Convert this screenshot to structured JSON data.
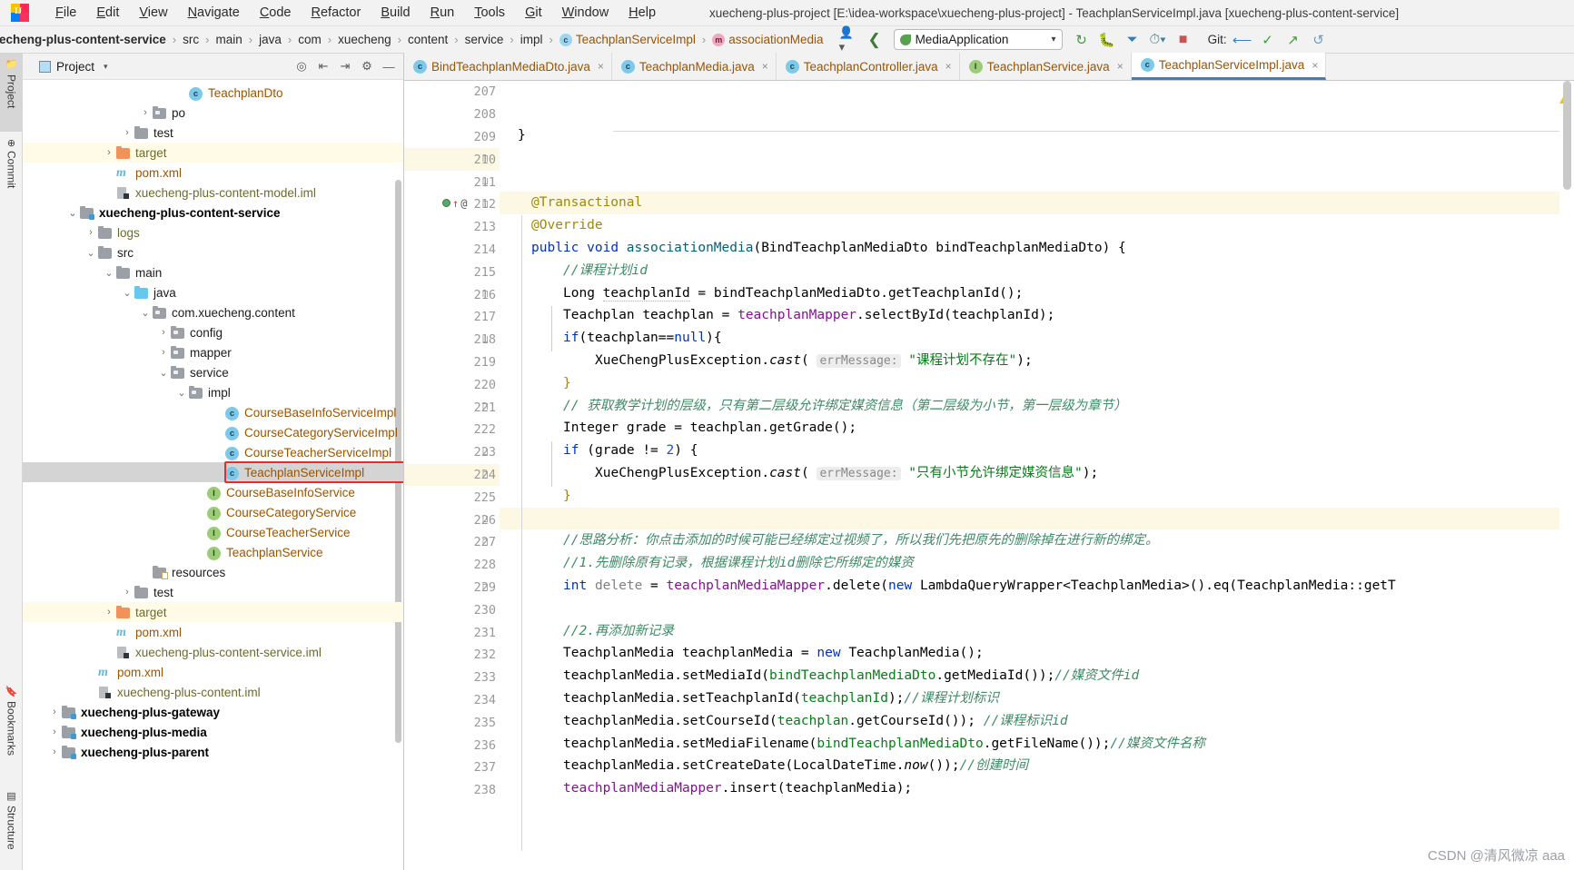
{
  "window": {
    "title": "xuecheng-plus-project [E:\\idea-workspace\\xuecheng-plus-project] - TeachplanServiceImpl.java [xuecheng-plus-content-service]",
    "logo_text": "IJ"
  },
  "menu": {
    "items": [
      {
        "label": "File",
        "mnemonic": "F"
      },
      {
        "label": "Edit",
        "mnemonic": "E"
      },
      {
        "label": "View",
        "mnemonic": "V"
      },
      {
        "label": "Navigate",
        "mnemonic": "N"
      },
      {
        "label": "Code",
        "mnemonic": "C"
      },
      {
        "label": "Refactor",
        "mnemonic": "R"
      },
      {
        "label": "Build",
        "mnemonic": "B"
      },
      {
        "label": "Run",
        "mnemonic": "R"
      },
      {
        "label": "Tools",
        "mnemonic": "T"
      },
      {
        "label": "Git",
        "mnemonic": "G"
      },
      {
        "label": "Window",
        "mnemonic": "W"
      },
      {
        "label": "Help",
        "mnemonic": "H"
      }
    ]
  },
  "breadcrumb": {
    "items": [
      {
        "label": "echeng-plus-content-service",
        "style": "bold",
        "icon": ""
      },
      {
        "label": "src",
        "style": "plain",
        "icon": ""
      },
      {
        "label": "main",
        "style": "plain",
        "icon": ""
      },
      {
        "label": "java",
        "style": "plain",
        "icon": ""
      },
      {
        "label": "com",
        "style": "plain",
        "icon": ""
      },
      {
        "label": "xuecheng",
        "style": "plain",
        "icon": ""
      },
      {
        "label": "content",
        "style": "plain",
        "icon": ""
      },
      {
        "label": "service",
        "style": "plain",
        "icon": ""
      },
      {
        "label": "impl",
        "style": "plain",
        "icon": ""
      },
      {
        "label": "TeachplanServiceImpl",
        "style": "class",
        "icon": "class-icon"
      },
      {
        "label": "associationMedia",
        "style": "class",
        "icon": "method-icon"
      }
    ],
    "separator": "›"
  },
  "toolbar": {
    "profile_icon": "user-icon",
    "back_icon": "back-arrow-icon",
    "run_config_label": "MediaApplication",
    "run_config_caret": "▾",
    "run_icon": "run-icon",
    "debug_icon": "debug-icon",
    "run_with_coverage_icon": "coverage-icon",
    "profiler_icon": "profiler-icon",
    "stop_icon": "stop-icon",
    "git_label": "Git:",
    "git_update_icon": "update-project-icon",
    "git_commit_icon": "commit-icon",
    "git_push_icon": "push-icon",
    "git_history_icon": "history-icon"
  },
  "left_strip": {
    "items": [
      {
        "label": "Project",
        "icon": "project-icon",
        "active": true
      },
      {
        "label": "Commit",
        "icon": "commit-icon",
        "active": false
      },
      {
        "label": "Bookmarks",
        "icon": "bookmark-icon",
        "active": false
      },
      {
        "label": "Structure",
        "icon": "structure-icon",
        "active": false
      }
    ]
  },
  "project_panel": {
    "title": "Project",
    "caret": "▾",
    "toolbar_icons": [
      "locate-icon",
      "expand-all-icon",
      "collapse-all-icon",
      "settings-gear-icon",
      "hide-icon"
    ],
    "tree": [
      {
        "indent": 8,
        "arrow": "",
        "icon": "class-icon",
        "label": "TeachplanDto",
        "color": "brown",
        "row": "normal"
      },
      {
        "indent": 6,
        "arrow": "›",
        "icon": "package-icon",
        "label": "po",
        "color": "plain",
        "row": "normal"
      },
      {
        "indent": 5,
        "arrow": "›",
        "icon": "folder-icon",
        "label": "test",
        "color": "plain",
        "row": "normal"
      },
      {
        "indent": 4,
        "arrow": "›",
        "icon": "folder-orange-icon",
        "label": "target",
        "color": "olive",
        "row": "yellow"
      },
      {
        "indent": 4,
        "arrow": "",
        "icon": "maven-icon",
        "label": "pom.xml",
        "color": "brown",
        "row": "normal"
      },
      {
        "indent": 4,
        "arrow": "",
        "icon": "iml-icon",
        "label": "xuecheng-plus-content-model.iml",
        "color": "olive",
        "row": "normal"
      },
      {
        "indent": 2,
        "arrow": "⌄",
        "icon": "module-icon",
        "label": "xuecheng-plus-content-service",
        "color": "bold",
        "row": "normal"
      },
      {
        "indent": 3,
        "arrow": "›",
        "icon": "folder-icon",
        "label": "logs",
        "color": "olive",
        "row": "normal"
      },
      {
        "indent": 3,
        "arrow": "⌄",
        "icon": "folder-icon",
        "label": "src",
        "color": "plain",
        "row": "normal"
      },
      {
        "indent": 4,
        "arrow": "⌄",
        "icon": "folder-icon",
        "label": "main",
        "color": "plain",
        "row": "normal"
      },
      {
        "indent": 5,
        "arrow": "⌄",
        "icon": "folder-blue-icon",
        "label": "java",
        "color": "plain",
        "row": "normal"
      },
      {
        "indent": 6,
        "arrow": "⌄",
        "icon": "package-icon",
        "label": "com.xuecheng.content",
        "color": "plain",
        "row": "normal"
      },
      {
        "indent": 7,
        "arrow": "›",
        "icon": "package-icon",
        "label": "config",
        "color": "plain",
        "row": "normal"
      },
      {
        "indent": 7,
        "arrow": "›",
        "icon": "package-icon",
        "label": "mapper",
        "color": "plain",
        "row": "normal"
      },
      {
        "indent": 7,
        "arrow": "⌄",
        "icon": "package-icon",
        "label": "service",
        "color": "plain",
        "row": "normal"
      },
      {
        "indent": 8,
        "arrow": "⌄",
        "icon": "package-icon",
        "label": "impl",
        "color": "plain",
        "row": "normal"
      },
      {
        "indent": 10,
        "arrow": "",
        "icon": "class-icon",
        "label": "CourseBaseInfoServiceImpl",
        "color": "brown",
        "row": "normal"
      },
      {
        "indent": 10,
        "arrow": "",
        "icon": "class-icon",
        "label": "CourseCategoryServiceImpl",
        "color": "brown",
        "row": "normal"
      },
      {
        "indent": 10,
        "arrow": "",
        "icon": "class-icon",
        "label": "CourseTeacherServiceImpl",
        "color": "brown",
        "row": "normal"
      },
      {
        "indent": 10,
        "arrow": "",
        "icon": "class-icon",
        "label": "TeachplanServiceImpl",
        "color": "brown",
        "row": "selected"
      },
      {
        "indent": 9,
        "arrow": "",
        "icon": "interface-icon",
        "label": "CourseBaseInfoService",
        "color": "brown",
        "row": "normal"
      },
      {
        "indent": 9,
        "arrow": "",
        "icon": "interface-icon",
        "label": "CourseCategoryService",
        "color": "brown",
        "row": "normal"
      },
      {
        "indent": 9,
        "arrow": "",
        "icon": "interface-icon",
        "label": "CourseTeacherService",
        "color": "brown",
        "row": "normal"
      },
      {
        "indent": 9,
        "arrow": "",
        "icon": "interface-icon",
        "label": "TeachplanService",
        "color": "brown",
        "row": "normal"
      },
      {
        "indent": 6,
        "arrow": "",
        "icon": "resources-icon",
        "label": "resources",
        "color": "plain",
        "row": "normal"
      },
      {
        "indent": 5,
        "arrow": "›",
        "icon": "folder-icon",
        "label": "test",
        "color": "plain",
        "row": "normal"
      },
      {
        "indent": 4,
        "arrow": "›",
        "icon": "folder-orange-icon",
        "label": "target",
        "color": "olive",
        "row": "yellow"
      },
      {
        "indent": 4,
        "arrow": "",
        "icon": "maven-icon",
        "label": "pom.xml",
        "color": "brown",
        "row": "normal"
      },
      {
        "indent": 4,
        "arrow": "",
        "icon": "iml-icon",
        "label": "xuecheng-plus-content-service.iml",
        "color": "olive",
        "row": "normal"
      },
      {
        "indent": 3,
        "arrow": "",
        "icon": "maven-icon",
        "label": "pom.xml",
        "color": "brown",
        "row": "normal"
      },
      {
        "indent": 3,
        "arrow": "",
        "icon": "iml-icon",
        "label": "xuecheng-plus-content.iml",
        "color": "olive",
        "row": "normal"
      },
      {
        "indent": 1,
        "arrow": "›",
        "icon": "module-icon",
        "label": "xuecheng-plus-gateway",
        "color": "bold",
        "row": "normal"
      },
      {
        "indent": 1,
        "arrow": "›",
        "icon": "module-icon",
        "label": "xuecheng-plus-media",
        "color": "bold",
        "row": "normal"
      },
      {
        "indent": 1,
        "arrow": "›",
        "icon": "module-icon",
        "label": "xuecheng-plus-parent",
        "color": "bold",
        "row": "normal"
      }
    ]
  },
  "editor_tabs": [
    {
      "label": "BindTeachplanMediaDto.java",
      "icon": "class-icon",
      "active": false,
      "close": "×"
    },
    {
      "label": "TeachplanMedia.java",
      "icon": "class-icon",
      "active": false,
      "close": "×"
    },
    {
      "label": "TeachplanController.java",
      "icon": "class-icon",
      "active": false,
      "close": "×"
    },
    {
      "label": "TeachplanService.java",
      "icon": "interface-icon",
      "active": false,
      "close": "×"
    },
    {
      "label": "TeachplanServiceImpl.java",
      "icon": "class-icon",
      "active": true,
      "close": "×"
    }
  ],
  "editor": {
    "first_line_number": 207,
    "line_numbers": [
      207,
      208,
      209,
      210,
      211,
      212,
      213,
      214,
      215,
      216,
      217,
      218,
      219,
      220,
      221,
      222,
      223,
      224,
      225,
      226,
      227,
      228,
      229,
      230,
      231,
      232,
      233,
      234,
      235,
      236,
      237,
      238
    ],
    "highlighted_lines": [
      210,
      224
    ],
    "gutter_marker_line": 212,
    "hint_label": "errMessage:",
    "code_lines": [
      "}",
      "",
      "",
      "@Transactional",
      "@Override",
      "public void associationMedia(BindTeachplanMediaDto bindTeachplanMediaDto) {",
      "//课程计划id",
      "Long teachplanId = bindTeachplanMediaDto.getTeachplanId();",
      "Teachplan teachplan = teachplanMapper.selectById(teachplanId);",
      "if(teachplan==null){",
      "XueChengPlusException.cast( errMessage: \"课程计划不存在\");",
      "}",
      "// 获取教学计划的层级，只有第二层级允许绑定媒资信息（第二层级为小节，第一层级为章节）",
      "Integer grade = teachplan.getGrade();",
      "if (grade != 2) {",
      "XueChengPlusException.cast( errMessage: \"只有小节允许绑定媒资信息\");",
      "}",
      "",
      "//思路分析：你点击添加的时候可能已经绑定过视频了，所以我们先把原先的删除掉在进行新的绑定。",
      "//1.先删除原有记录，根据课程计划id删除它所绑定的媒资",
      "int delete = teachplanMediaMapper.delete(new LambdaQueryWrapper<TeachplanMedia>().eq(TeachplanMedia::getT",
      "",
      "//2.再添加新记录",
      "TeachplanMedia teachplanMedia = new TeachplanMedia();",
      "teachplanMedia.setMediaId(bindTeachplanMediaDto.getMediaId());//媒资文件id",
      "teachplanMedia.setTeachplanId(teachplanId);//课程计划标识",
      "teachplanMedia.setCourseId(teachplan.getCourseId()); //课程标识id",
      "teachplanMedia.setMediaFilename(bindTeachplanMediaDto.getFileName());//媒资文件名称",
      "teachplanMedia.setCreateDate(LocalDateTime.now());//创建时间",
      "teachplanMediaMapper.insert(teachplanMedia);",
      ""
    ]
  },
  "watermark": "CSDN @清风微凉 aaa",
  "colors": {
    "accent": "#3d7dc4",
    "selection": "#d4d4d4",
    "annotation_box": "#ef2929",
    "highlight_line": "#fdf8e3",
    "string": "#067d17",
    "comment": "#3f8b66",
    "keyword": "#0033b3"
  }
}
